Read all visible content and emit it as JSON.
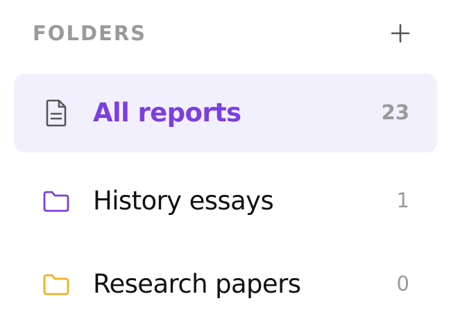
{
  "header": {
    "title": "FOLDERS",
    "add_icon": "plus-icon"
  },
  "colors": {
    "accent": "#7b3fe0",
    "active_bg": "#f3f0fd",
    "muted": "#9a9a9a",
    "folder_purple": "#7b3fe0",
    "folder_yellow": "#f2b020"
  },
  "folders": [
    {
      "label": "All reports",
      "count": "23",
      "icon": "document-icon",
      "active": true
    },
    {
      "label": "History essays",
      "count": "1",
      "icon": "folder-icon",
      "icon_color": "#7b3fe0",
      "active": false
    },
    {
      "label": "Research papers",
      "count": "0",
      "icon": "folder-icon",
      "icon_color": "#f2b020",
      "active": false
    }
  ]
}
